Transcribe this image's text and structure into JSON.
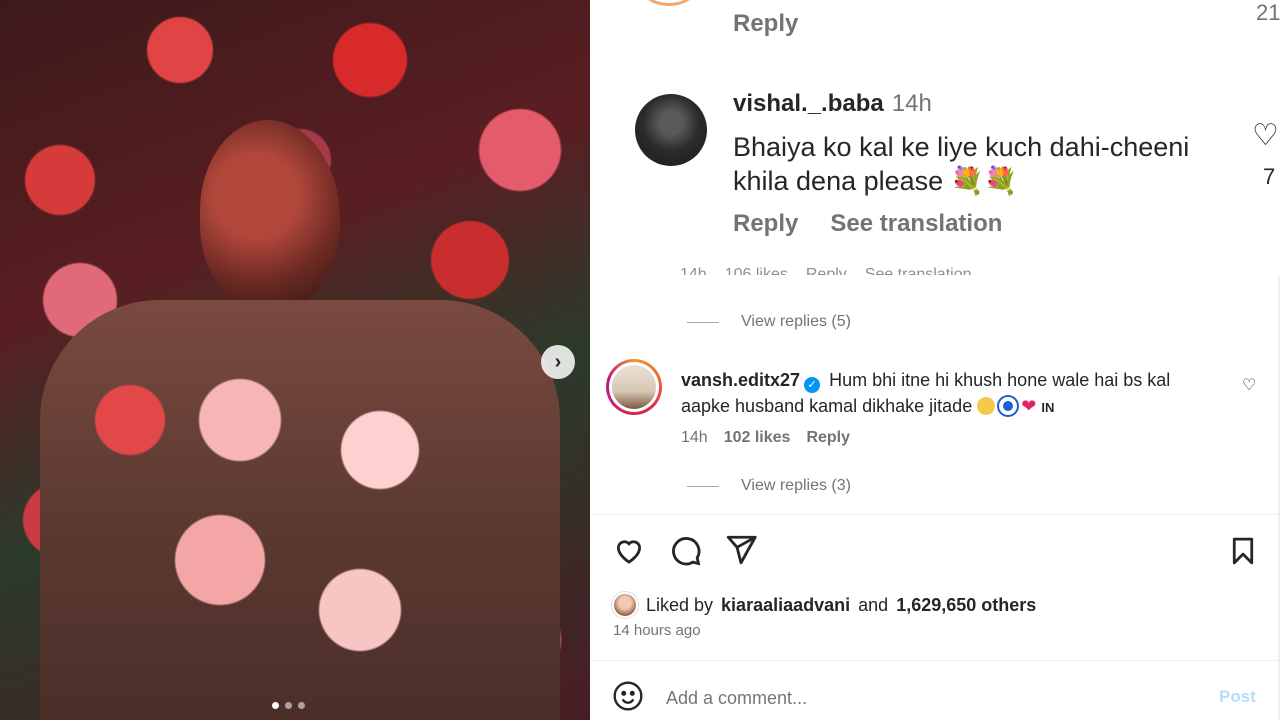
{
  "post_image": {
    "carousel_dots": 3,
    "active_dot_index": 0,
    "next_icon": "chevron-right-icon"
  },
  "zoomed": {
    "prev_reply_label": "Reply",
    "prev_like_count": "21",
    "comment": {
      "username": "vishal._.baba",
      "time": "14h",
      "text": "Bhaiya ko kal ke liye kuch dahi-cheeni khila dena please 💐💐",
      "reply_label": "Reply",
      "translation_label": "See translation",
      "like_count": "7"
    },
    "clipped_meta": [
      "14h",
      "106 likes",
      "Reply",
      "See translation"
    ]
  },
  "replies_1": {
    "label": "View replies (5)"
  },
  "comment2": {
    "username": "vansh.editx27",
    "text_a": "Hum bhi itne hi khush hone wale hai bs kal aapke husband kamal dikhake jitade",
    "flag": "IN",
    "time": "14h",
    "likes": "102 likes",
    "reply_label": "Reply"
  },
  "replies_2": {
    "label": "View replies (3)"
  },
  "actions": {
    "like_icon": "heart-icon",
    "comment_icon": "comment-icon",
    "share_icon": "send-icon",
    "save_icon": "bookmark-icon"
  },
  "liked_by": {
    "prefix": "Liked by",
    "user": "kiaraaliaadvani",
    "middle": "and",
    "others": "1,629,650 others"
  },
  "timestamp": "14 hours ago",
  "add_comment": {
    "placeholder": "Add a comment...",
    "post_label": "Post"
  },
  "colors": {
    "accent_blue": "#0095f6",
    "post_disabled": "#b2dffc",
    "secondary_text": "#737373"
  }
}
